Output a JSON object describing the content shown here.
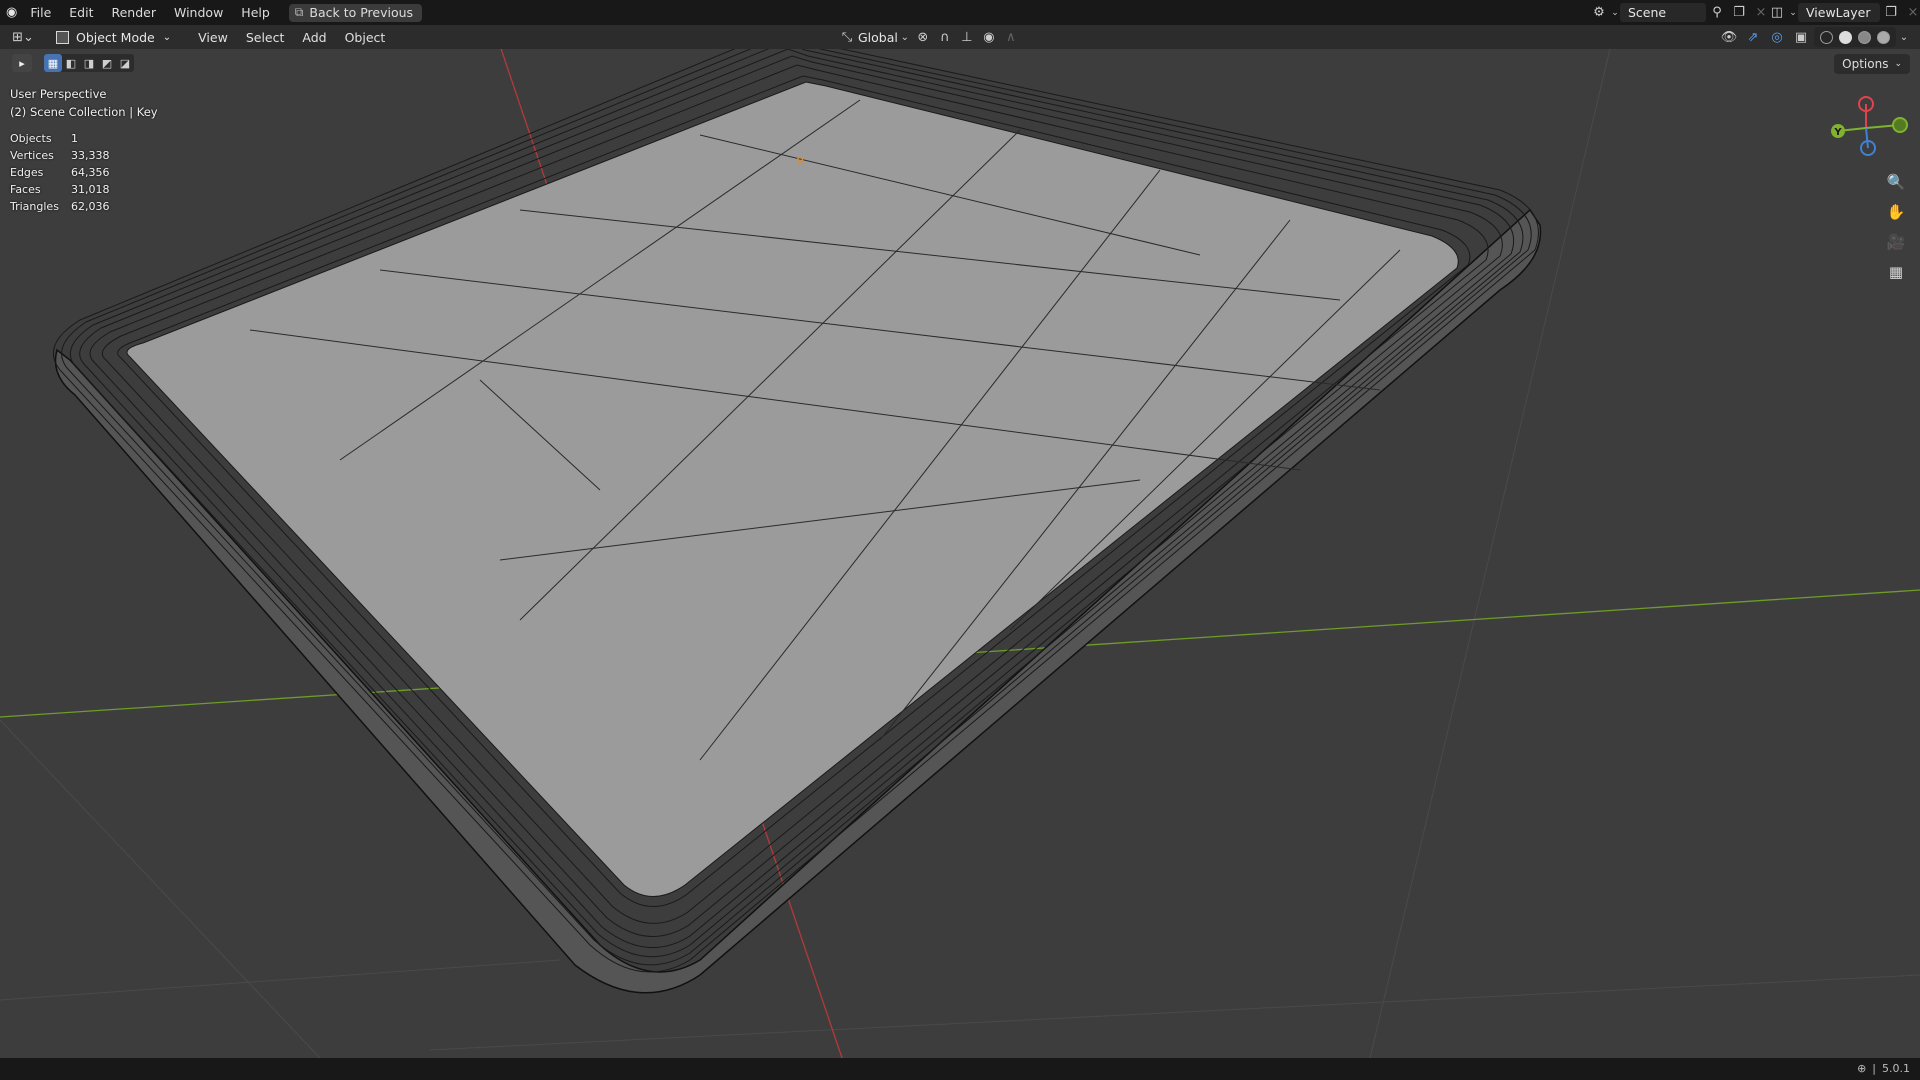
{
  "topbar": {
    "menus": [
      "File",
      "Edit",
      "Render",
      "Window",
      "Help"
    ],
    "back_button": "Back to Previous",
    "scene_name": "Scene",
    "view_layer": "ViewLayer"
  },
  "header": {
    "mode": "Object Mode",
    "menus": [
      "View",
      "Select",
      "Add",
      "Object"
    ],
    "transform_orientation": "Global"
  },
  "options_label": "Options",
  "viewport": {
    "perspective_label": "User Perspective",
    "collection_label": "(2) Scene Collection | Key"
  },
  "stats": {
    "rows": [
      {
        "label": "Objects",
        "value": "1"
      },
      {
        "label": "Vertices",
        "value": "33,338"
      },
      {
        "label": "Edges",
        "value": "64,356"
      },
      {
        "label": "Faces",
        "value": "31,018"
      },
      {
        "label": "Triangles",
        "value": "62,036"
      }
    ]
  },
  "gizmo": {
    "y_label": "Y",
    "x_color": "#e0434e",
    "y_color": "#7fb32e",
    "z_color": "#3f81d6"
  },
  "status": {
    "version": "5.0.1"
  },
  "colors": {
    "accent": "#4772b3",
    "x_axis": "#b33a3a",
    "y_axis": "#6e9c2a"
  }
}
